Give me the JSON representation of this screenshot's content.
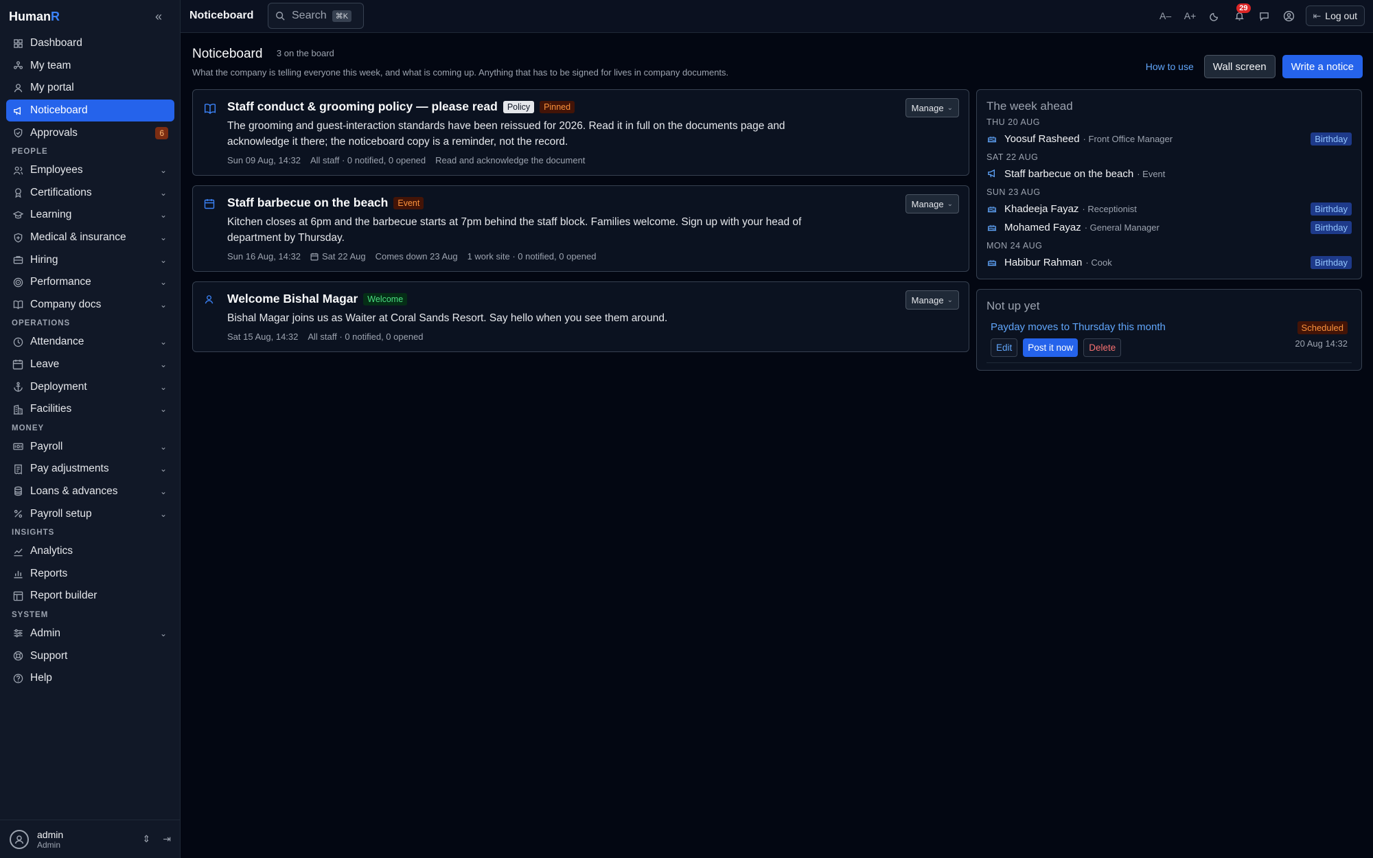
{
  "brand": {
    "name": "Human",
    "accent": "R"
  },
  "sidebar": {
    "items": [
      {
        "type": "item",
        "label": "Dashboard",
        "icon": "grid-icon"
      },
      {
        "type": "item",
        "label": "My team",
        "icon": "team-icon"
      },
      {
        "type": "item",
        "label": "My portal",
        "icon": "user-icon"
      },
      {
        "type": "item",
        "label": "Noticeboard",
        "icon": "megaphone-icon",
        "active": true
      },
      {
        "type": "item",
        "label": "Approvals",
        "icon": "shield-check-icon",
        "count": "6"
      },
      {
        "type": "section",
        "label": "PEOPLE"
      },
      {
        "type": "item",
        "label": "Employees",
        "icon": "users-icon",
        "expandable": true
      },
      {
        "type": "item",
        "label": "Certifications",
        "icon": "award-icon",
        "expandable": true
      },
      {
        "type": "item",
        "label": "Learning",
        "icon": "graduation-cap-icon",
        "expandable": true
      },
      {
        "type": "item",
        "label": "Medical & insurance",
        "icon": "shield-plus-icon",
        "expandable": true
      },
      {
        "type": "item",
        "label": "Hiring",
        "icon": "briefcase-icon",
        "expandable": true
      },
      {
        "type": "item",
        "label": "Performance",
        "icon": "target-icon",
        "expandable": true
      },
      {
        "type": "item",
        "label": "Company docs",
        "icon": "book-icon",
        "expandable": true
      },
      {
        "type": "section",
        "label": "OPERATIONS"
      },
      {
        "type": "item",
        "label": "Attendance",
        "icon": "clock-icon",
        "expandable": true
      },
      {
        "type": "item",
        "label": "Leave",
        "icon": "calendar-icon",
        "expandable": true
      },
      {
        "type": "item",
        "label": "Deployment",
        "icon": "anchor-icon",
        "expandable": true
      },
      {
        "type": "item",
        "label": "Facilities",
        "icon": "building-icon",
        "expandable": true
      },
      {
        "type": "section",
        "label": "MONEY"
      },
      {
        "type": "item",
        "label": "Payroll",
        "icon": "payroll-icon",
        "expandable": true
      },
      {
        "type": "item",
        "label": "Pay adjustments",
        "icon": "receipt-icon",
        "expandable": true
      },
      {
        "type": "item",
        "label": "Loans & advances",
        "icon": "coins-icon",
        "expandable": true
      },
      {
        "type": "item",
        "label": "Payroll setup",
        "icon": "percent-icon",
        "expandable": true
      },
      {
        "type": "section",
        "label": "INSIGHTS"
      },
      {
        "type": "item",
        "label": "Analytics",
        "icon": "line-chart-icon"
      },
      {
        "type": "item",
        "label": "Reports",
        "icon": "bar-chart-icon"
      },
      {
        "type": "item",
        "label": "Report builder",
        "icon": "layout-icon"
      },
      {
        "type": "section",
        "label": "SYSTEM"
      },
      {
        "type": "item",
        "label": "Admin",
        "icon": "sliders-icon",
        "expandable": true
      },
      {
        "type": "item",
        "label": "Support",
        "icon": "lifebuoy-icon"
      },
      {
        "type": "item",
        "label": "Help",
        "icon": "help-circle-icon"
      }
    ],
    "user": {
      "name": "admin",
      "role": "Admin"
    }
  },
  "topbar": {
    "title": "Noticeboard",
    "search_placeholder": "Search",
    "search_shortcut": "⌘K",
    "font_smaller": "A–",
    "font_larger": "A+",
    "notification_count": "29",
    "logout_label": "Log out"
  },
  "page": {
    "title": "Noticeboard",
    "count_label": "3 on the board",
    "description": "What the company is telling everyone this week, and what is coming up. Anything that has to be signed for lives in company documents.",
    "how_to_use": "How to use",
    "wall_screen": "Wall screen",
    "write_notice": "Write a notice"
  },
  "notices": [
    {
      "icon": "book-open-icon",
      "title": "Staff conduct & grooming policy — please read",
      "tags": [
        {
          "label": "Policy",
          "kind": "policy"
        },
        {
          "label": "Pinned",
          "kind": "pinned"
        }
      ],
      "body": "The grooming and guest-interaction standards have been reissued for 2026. Read it in full on the documents page and acknowledge it there; the noticeboard copy is a reminder, not the record.",
      "meta": [
        "Sun 09 Aug, 14:32",
        "All staff · 0 notified, 0 opened",
        "Read and acknowledge the document"
      ],
      "manage": "Manage"
    },
    {
      "icon": "calendar-icon",
      "title": "Staff barbecue on the beach",
      "tags": [
        {
          "label": "Event",
          "kind": "event"
        }
      ],
      "body": "Kitchen closes at 6pm and the barbecue starts at 7pm behind the staff block. Families welcome. Sign up with your head of department by Thursday.",
      "meta": [
        "Sun 16 Aug, 14:32",
        "Sat 22 Aug",
        "Comes down 23 Aug",
        "1 work site · 0 notified, 0 opened"
      ],
      "manage": "Manage"
    },
    {
      "icon": "user-icon",
      "title": "Welcome Bishal Magar",
      "tags": [
        {
          "label": "Welcome",
          "kind": "welcome"
        }
      ],
      "body": "Bishal Magar joins us as Waiter at Coral Sands Resort. Say hello when you see them around.",
      "meta": [
        "Sat 15 Aug, 14:32",
        "All staff · 0 notified, 0 opened"
      ],
      "manage": "Manage"
    }
  ],
  "week_ahead": {
    "title": "The week ahead",
    "days": [
      {
        "day": "THU 20 AUG",
        "entries": [
          {
            "name": "Yoosuf Rasheed",
            "role": "Front Office Manager",
            "badge": "Birthday",
            "icon": "cake-icon"
          }
        ]
      },
      {
        "day": "SAT 22 AUG",
        "entries": [
          {
            "name": "Staff barbecue on the beach",
            "role": "Event",
            "badge": "",
            "icon": "megaphone-icon"
          }
        ]
      },
      {
        "day": "SUN 23 AUG",
        "entries": [
          {
            "name": "Khadeeja Fayaz",
            "role": "Receptionist",
            "badge": "Birthday",
            "icon": "cake-icon"
          },
          {
            "name": "Mohamed Fayaz",
            "role": "General Manager",
            "badge": "Birthday",
            "icon": "cake-icon"
          }
        ]
      },
      {
        "day": "MON 24 AUG",
        "entries": [
          {
            "name": "Habibur Rahman",
            "role": "Cook",
            "badge": "Birthday",
            "icon": "cake-icon"
          }
        ]
      }
    ]
  },
  "not_up_yet": {
    "title": "Not up yet",
    "item": {
      "title": "Payday moves to Thursday this month",
      "status": "Scheduled",
      "time": "20 Aug 14:32",
      "edit": "Edit",
      "post_now": "Post it now",
      "delete": "Delete"
    }
  }
}
